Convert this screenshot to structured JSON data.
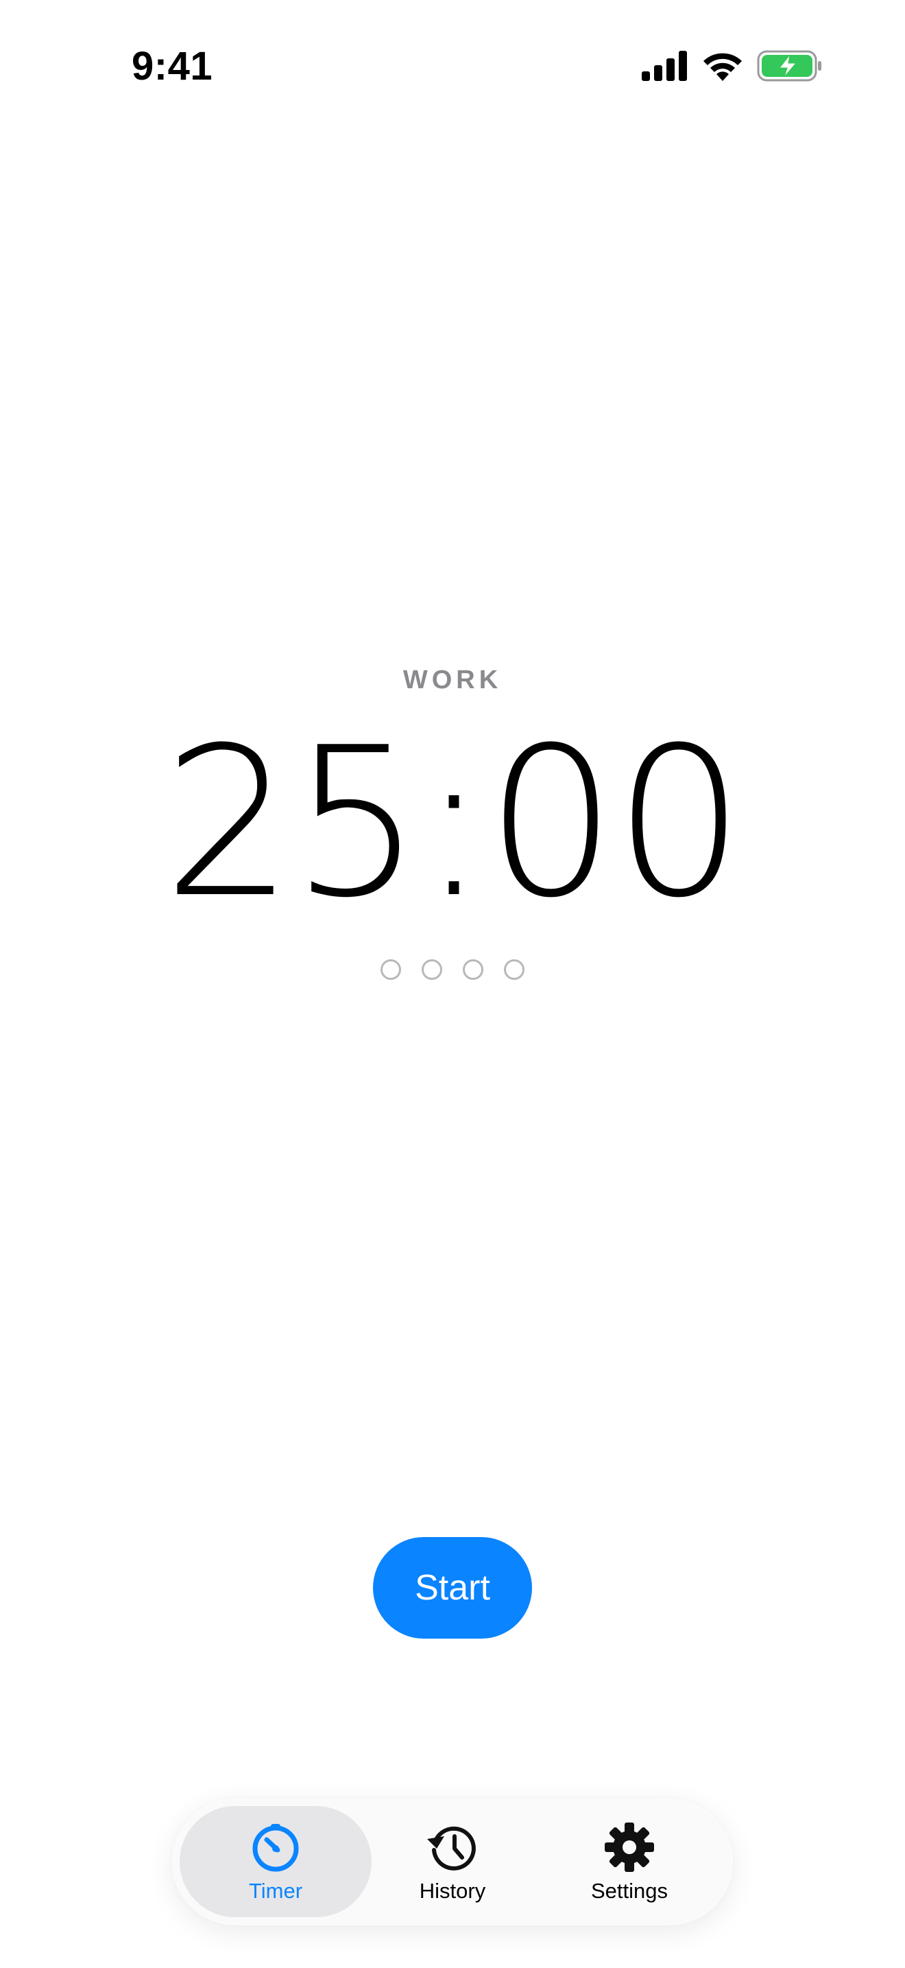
{
  "status_bar": {
    "time": "9:41",
    "icons": [
      "cellular-signal-icon",
      "wifi-icon",
      "battery-charging-icon"
    ],
    "battery_color": "#34c759"
  },
  "timer": {
    "mode": "WORK",
    "time": "25:00",
    "sessions_completed": 0,
    "sessions_total": 4
  },
  "controls": {
    "start_label": "Start",
    "accent_color": "#0a84ff"
  },
  "tab_bar": {
    "tabs": [
      {
        "label": "Timer",
        "icon": "timer-icon",
        "active": true
      },
      {
        "label": "History",
        "icon": "history-icon",
        "active": false
      },
      {
        "label": "Settings",
        "icon": "gear-icon",
        "active": false
      }
    ]
  }
}
